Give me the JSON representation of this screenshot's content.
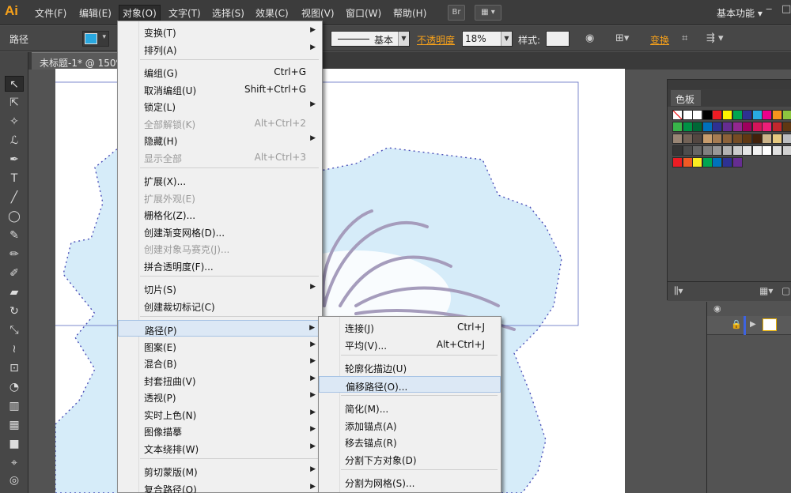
{
  "menubar": {
    "logo": "Ai",
    "items": [
      "文件(F)",
      "编辑(E)",
      "对象(O)",
      "文字(T)",
      "选择(S)",
      "效果(C)",
      "视图(V)",
      "窗口(W)",
      "帮助(H)"
    ],
    "bridge_label": "Br",
    "workspace": "基本功能",
    "window_controls": [
      "‒",
      "□"
    ]
  },
  "controlbar": {
    "title": "路径",
    "fill_color": "#29a8e0",
    "stroke_label": "基本",
    "opacity_label": "不透明度",
    "opacity_value": "18%",
    "style_label": "样式:",
    "transform_label": "变换"
  },
  "document": {
    "tab_title": "未标题-1* @ 150%"
  },
  "object_menu": {
    "items": [
      {
        "label": "变换(T)",
        "shortcut": "",
        "submenu": true,
        "disabled": false
      },
      {
        "label": "排列(A)",
        "shortcut": "",
        "submenu": true,
        "disabled": false
      },
      {
        "label": "编组(G)",
        "shortcut": "Ctrl+G",
        "submenu": false,
        "disabled": false
      },
      {
        "label": "取消编组(U)",
        "shortcut": "Shift+Ctrl+G",
        "submenu": false,
        "disabled": false
      },
      {
        "label": "锁定(L)",
        "shortcut": "",
        "submenu": true,
        "disabled": false
      },
      {
        "label": "全部解锁(K)",
        "shortcut": "Alt+Ctrl+2",
        "submenu": false,
        "disabled": true
      },
      {
        "label": "隐藏(H)",
        "shortcut": "",
        "submenu": true,
        "disabled": false
      },
      {
        "label": "显示全部",
        "shortcut": "Alt+Ctrl+3",
        "submenu": false,
        "disabled": true
      },
      {
        "label": "扩展(X)...",
        "shortcut": "",
        "submenu": false,
        "disabled": false
      },
      {
        "label": "扩展外观(E)",
        "shortcut": "",
        "submenu": false,
        "disabled": true
      },
      {
        "label": "栅格化(Z)...",
        "shortcut": "",
        "submenu": false,
        "disabled": false
      },
      {
        "label": "创建渐变网格(D)...",
        "shortcut": "",
        "submenu": false,
        "disabled": false
      },
      {
        "label": "创建对象马赛克(J)...",
        "shortcut": "",
        "submenu": false,
        "disabled": true
      },
      {
        "label": "拼合透明度(F)...",
        "shortcut": "",
        "submenu": false,
        "disabled": false
      },
      {
        "label": "切片(S)",
        "shortcut": "",
        "submenu": true,
        "disabled": false
      },
      {
        "label": "创建裁切标记(C)",
        "shortcut": "",
        "submenu": false,
        "disabled": false
      },
      {
        "label": "路径(P)",
        "shortcut": "",
        "submenu": true,
        "disabled": false,
        "highlighted": true
      },
      {
        "label": "图案(E)",
        "shortcut": "",
        "submenu": true,
        "disabled": false
      },
      {
        "label": "混合(B)",
        "shortcut": "",
        "submenu": true,
        "disabled": false
      },
      {
        "label": "封套扭曲(V)",
        "shortcut": "",
        "submenu": true,
        "disabled": false
      },
      {
        "label": "透视(P)",
        "shortcut": "",
        "submenu": true,
        "disabled": false
      },
      {
        "label": "实时上色(N)",
        "shortcut": "",
        "submenu": true,
        "disabled": false
      },
      {
        "label": "图像描摹",
        "shortcut": "",
        "submenu": true,
        "disabled": false
      },
      {
        "label": "文本绕排(W)",
        "shortcut": "",
        "submenu": true,
        "disabled": false
      },
      {
        "label": "剪切蒙版(M)",
        "shortcut": "",
        "submenu": true,
        "disabled": false
      },
      {
        "label": "复合路径(O)",
        "shortcut": "",
        "submenu": true,
        "disabled": false
      }
    ]
  },
  "path_submenu": {
    "items": [
      {
        "label": "连接(J)",
        "shortcut": "Ctrl+J"
      },
      {
        "label": "平均(V)...",
        "shortcut": "Alt+Ctrl+J"
      },
      {
        "label": "轮廓化描边(U)",
        "shortcut": ""
      },
      {
        "label": "偏移路径(O)...",
        "shortcut": "",
        "highlighted": true
      },
      {
        "label": "简化(M)...",
        "shortcut": ""
      },
      {
        "label": "添加锚点(A)",
        "shortcut": ""
      },
      {
        "label": "移去锚点(R)",
        "shortcut": ""
      },
      {
        "label": "分割下方对象(D)",
        "shortcut": ""
      },
      {
        "label": "分割为网格(S)...",
        "shortcut": ""
      }
    ]
  },
  "color_panel": {
    "title": "色板",
    "swatch_rows": [
      [
        "none",
        "#ffffff",
        "#ffffff",
        "#000000",
        "#ed1c24",
        "#fff200",
        "#00a651",
        "#2e3192",
        "#29abe2",
        "#ec008c",
        "#f7941d",
        "#8dc63f"
      ],
      [
        "#39b54a",
        "#009245",
        "#006837",
        "#0071bc",
        "#2e3192",
        "#662d91",
        "#93278f",
        "#9e005d",
        "#d4145a",
        "#ed1e79",
        "#c1272d",
        "#603813"
      ],
      [
        "#998675",
        "#736357",
        "#534741",
        "#c69c6d",
        "#a67c52",
        "#8c6239",
        "#754c24",
        "#603813",
        "#42210b",
        "#ccb48a",
        "#e6c97f",
        "#bcbec0"
      ],
      [
        "#363636",
        "#4d4d4d",
        "#666666",
        "#808080",
        "#999999",
        "#b3b3b3",
        "#cccccc",
        "#e6e6e6",
        "#f2f2f2",
        "#ffffff",
        "#e0e0e0",
        "#d0d0d0"
      ],
      [
        "#ed1c24",
        "#f15a24",
        "#fcee21",
        "#00a651",
        "#0071bc",
        "#2e3192",
        "#662d91"
      ]
    ]
  }
}
